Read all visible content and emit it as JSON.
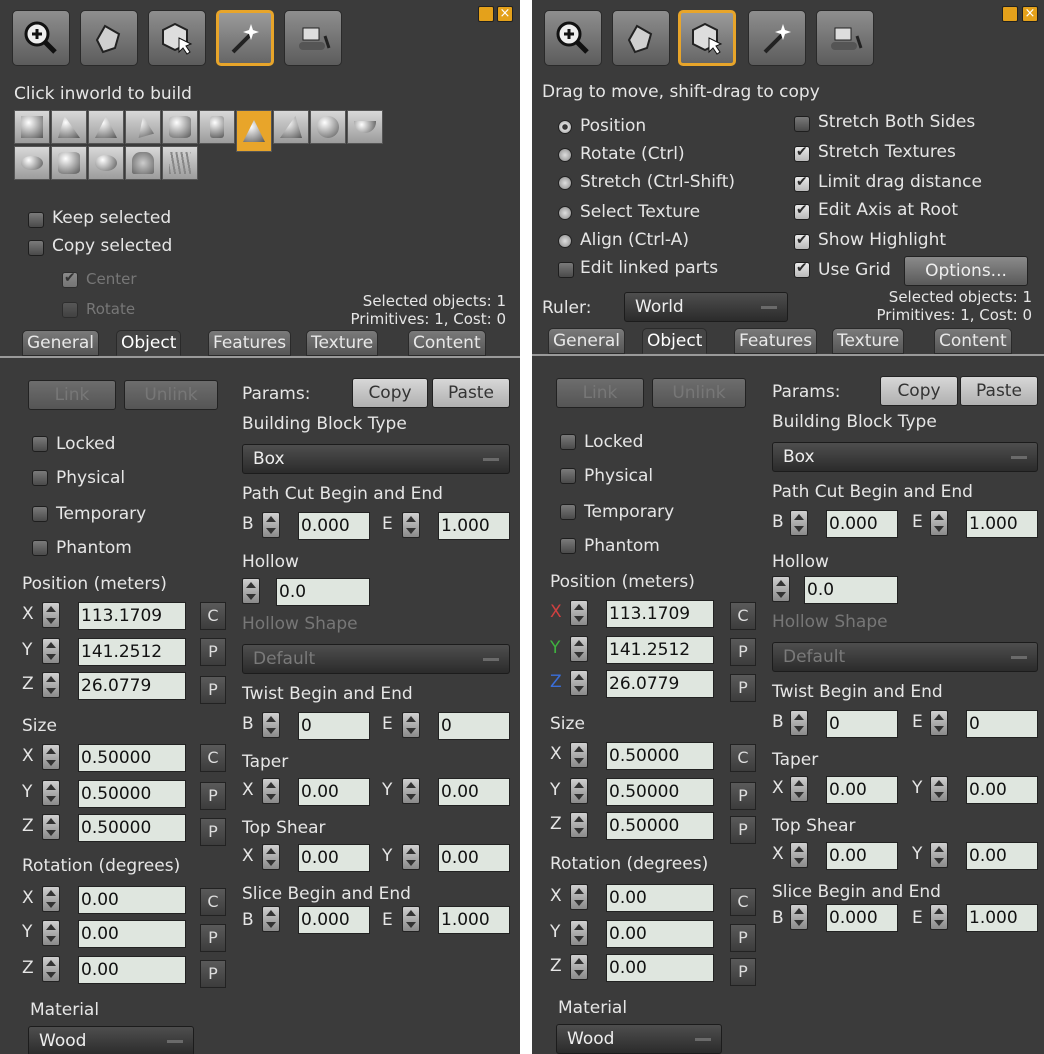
{
  "left": {
    "hint": "Click inworld to build",
    "keep_selected": "Keep selected",
    "copy_selected": "Copy selected",
    "center": "Center",
    "rotate": "Rotate",
    "selected_objects": "Selected objects: 1",
    "primitives": "Primitives: 1, Cost: 0"
  },
  "right": {
    "hint": "Drag to move, shift-drag to copy",
    "radios": [
      "Position",
      "Rotate (Ctrl)",
      "Stretch (Ctrl-Shift)",
      "Select Texture",
      "Align (Ctrl-A)"
    ],
    "edit_linked": "Edit linked parts",
    "checks": [
      "Stretch Both Sides",
      "Stretch Textures",
      "Limit drag distance",
      "Edit Axis at Root",
      "Show Highlight",
      "Use Grid"
    ],
    "options": "Options...",
    "ruler_label": "Ruler:",
    "ruler_value": "World",
    "selected_objects": "Selected objects: 1",
    "primitives": "Primitives: 1, Cost: 0"
  },
  "tabs": [
    "General",
    "Object",
    "Features",
    "Texture",
    "Content"
  ],
  "obj": {
    "link": "Link",
    "unlink": "Unlink",
    "params": "Params:",
    "copy": "Copy",
    "paste": "Paste",
    "locked": "Locked",
    "physical": "Physical",
    "temporary": "Temporary",
    "phantom": "Phantom",
    "position_label": "Position (meters)",
    "size_label": "Size",
    "rotation_label": "Rotation (degrees)",
    "axis_x": "X",
    "axis_y": "Y",
    "axis_z": "Z",
    "c": "C",
    "p": "P",
    "pos": [
      "113.1709",
      "141.2512",
      "26.0779"
    ],
    "size": [
      "0.50000",
      "0.50000",
      "0.50000"
    ],
    "rot": [
      "0.00",
      "0.00",
      "0.00"
    ],
    "material_label": "Material",
    "material": "Wood",
    "bbt_label": "Building Block Type",
    "bbt": "Box",
    "pathcut_label": "Path Cut Begin and End",
    "b": "B",
    "e": "E",
    "pathcut_b": "0.000",
    "pathcut_e": "1.000",
    "hollow_label": "Hollow",
    "hollow": "0.0",
    "hollow_shape_label": "Hollow Shape",
    "hollow_shape": "Default",
    "twist_label": "Twist Begin and End",
    "twist_b": "0",
    "twist_e": "0",
    "taper_label": "Taper",
    "taper_x": "0.00",
    "taper_y": "0.00",
    "shear_label": "Top Shear",
    "shear_x": "0.00",
    "shear_y": "0.00",
    "slice_label": "Slice Begin and End",
    "slice_b": "0.000",
    "slice_e": "1.000"
  },
  "colors": {
    "accent": "#e8a52a",
    "panel": "#3b3b3b"
  }
}
